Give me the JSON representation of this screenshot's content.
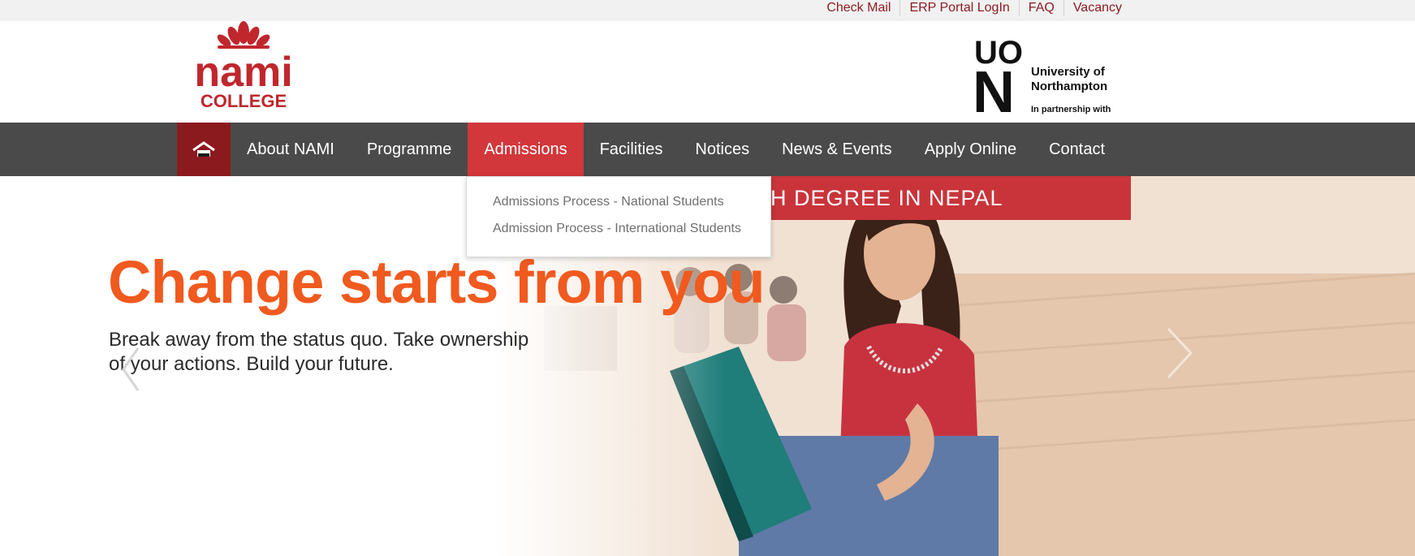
{
  "top_links": [
    "Check Mail",
    "ERP Portal LogIn",
    "FAQ",
    "Vacancy"
  ],
  "logo": {
    "nami_word": "nami",
    "college_word": "COLLEGE",
    "partner_letters": "UO",
    "partner_letter2": "N",
    "partner_line1": "University of",
    "partner_line2": "Northampton",
    "partner_line3": "In partnership with"
  },
  "nav": {
    "home_icon": "home-icon",
    "items": [
      "About NAMI",
      "Programme",
      "Admissions",
      "Facilities",
      "Notices",
      "News & Events",
      "Apply Online",
      "Contact"
    ],
    "active": "Admissions"
  },
  "dropdown": {
    "items": [
      "Admissions Process - National Students",
      "Admission Process - International Students"
    ]
  },
  "hero": {
    "banner_text": "SH DEGREE IN NEPAL",
    "headline": "Change starts from you",
    "subline_1": "Break away from the status quo. Take ownership",
    "subline_2": "of your actions. Build your future."
  },
  "colors": {
    "brand_red": "#8b1c24",
    "nav_bg": "#4a4a4a",
    "nav_active": "#d2373b",
    "headline_orange": "#f05a1f"
  }
}
